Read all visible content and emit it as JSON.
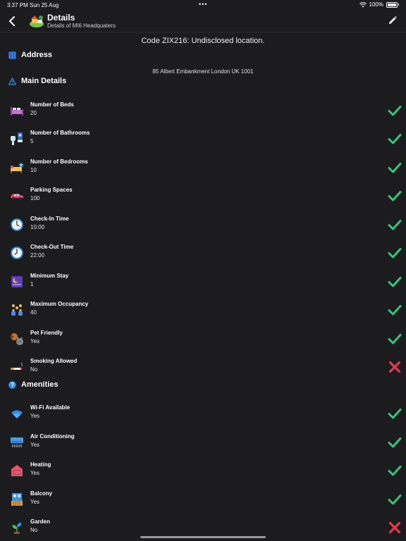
{
  "status_bar": {
    "time": "3:37 PM",
    "date": "Sun 25 Aug",
    "battery": "100%"
  },
  "nav": {
    "title": "Details",
    "subtitle": "Details of MI6 Headquaters"
  },
  "code_line": "Code ZIX216: Undisclosed location.",
  "address": {
    "header": "Address",
    "text": "85 Albert Embankment  London UK 1001"
  },
  "main_details": {
    "header": "Main Details",
    "items": [
      {
        "label": "Number of Beds",
        "value": "20",
        "ok": true
      },
      {
        "label": "Number of Bathrooms",
        "value": "5",
        "ok": true
      },
      {
        "label": "Number of Bedrooms",
        "value": "10",
        "ok": true
      },
      {
        "label": "Parking Spaces",
        "value": "100",
        "ok": true
      },
      {
        "label": "Check-In Time",
        "value": "10:00",
        "ok": true
      },
      {
        "label": "Check-Out Time",
        "value": "22:00",
        "ok": true
      },
      {
        "label": "Minimum Stay",
        "value": "1",
        "ok": true
      },
      {
        "label": "Maximum Occupancy",
        "value": "40",
        "ok": true
      },
      {
        "label": "Pet Friendly",
        "value": "Yes",
        "ok": true
      },
      {
        "label": "Smoking Allowed",
        "value": "No",
        "ok": false
      }
    ]
  },
  "amenities": {
    "header": "Amenities",
    "items": [
      {
        "label": "Wi-Fi Available",
        "value": "Yes",
        "ok": true
      },
      {
        "label": "Air Conditioning",
        "value": "Yes",
        "ok": true
      },
      {
        "label": "Heating",
        "value": "Yes",
        "ok": true
      },
      {
        "label": "Balcony",
        "value": "Yes",
        "ok": true
      },
      {
        "label": "Garden",
        "value": "No",
        "ok": false
      }
    ]
  },
  "colors": {
    "check": "#34c77b",
    "cross": "#e8364f",
    "accent": "#2f8cf5"
  }
}
